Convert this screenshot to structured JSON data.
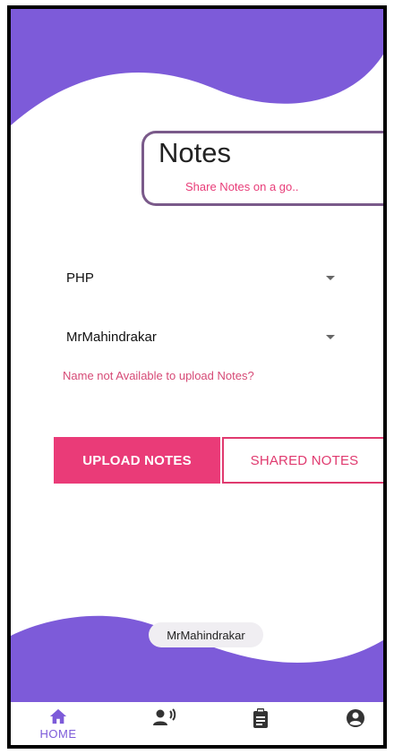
{
  "header": {
    "title": "Notes",
    "subtitle": "Share Notes on a go.."
  },
  "form": {
    "subject_selected": "PHP",
    "name_selected": "MrMahindrakar",
    "name_unavailable_link": "Name not Available to upload Notes?"
  },
  "actions": {
    "upload_label": "UPLOAD NOTES",
    "shared_label": "SHARED NOTES"
  },
  "toast": {
    "text": "MrMahindrakar"
  },
  "bottom_nav": {
    "items": [
      {
        "icon": "home-icon",
        "label": "HOME",
        "active": true
      },
      {
        "icon": "voice-icon",
        "label": "",
        "active": false
      },
      {
        "icon": "clipboard-icon",
        "label": "",
        "active": false
      },
      {
        "icon": "account-icon",
        "label": "",
        "active": false
      }
    ]
  },
  "colors": {
    "purple": "#7d5bd9",
    "pink": "#ea3b78",
    "card_border": "#7a5a8a"
  }
}
